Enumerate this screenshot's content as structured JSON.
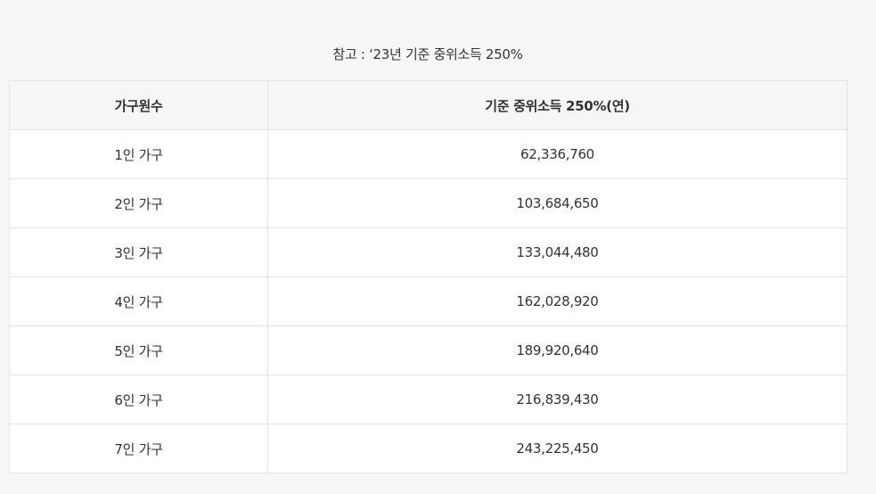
{
  "caption": "참고 : ‘23년 기준 중위소득 250%",
  "table": {
    "headers": [
      "가구원수",
      "기준 중위소득 250%(연)"
    ],
    "rows": [
      [
        "1인 가구",
        "62,336,760"
      ],
      [
        "2인 가구",
        "103,684,650"
      ],
      [
        "3인 가구",
        "133,044,480"
      ],
      [
        "4인 가구",
        "162,028,920"
      ],
      [
        "5인 가구",
        "189,920,640"
      ],
      [
        "6인 가구",
        "216,839,430"
      ],
      [
        "7인 가구",
        "243,225,450"
      ]
    ]
  }
}
